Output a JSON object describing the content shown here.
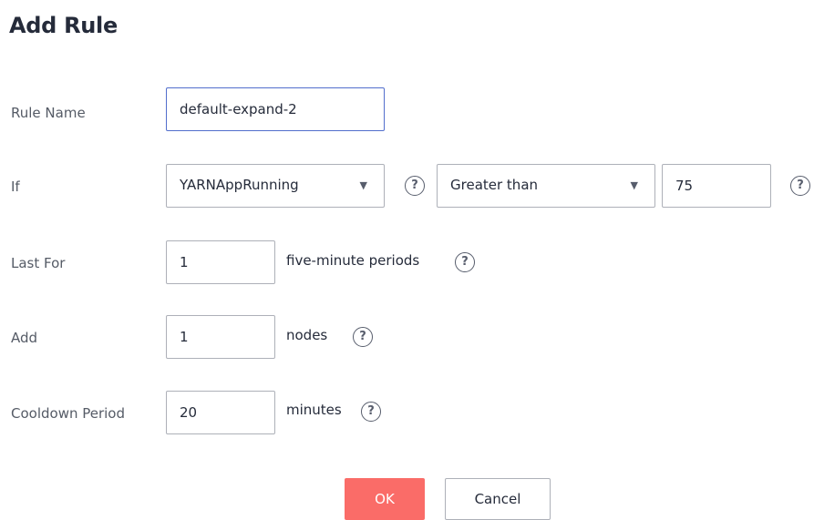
{
  "dialog": {
    "title": "Add Rule"
  },
  "rule_name": {
    "label": "Rule Name",
    "value": "default-expand-2"
  },
  "condition": {
    "label": "If",
    "metric": "YARNAppRunning",
    "operator": "Greater than",
    "threshold": "75"
  },
  "last_for": {
    "label": "Last For",
    "value": "1",
    "unit": "five-minute periods"
  },
  "add": {
    "label": "Add",
    "value": "1",
    "unit": "nodes"
  },
  "cooldown": {
    "label": "Cooldown Period",
    "value": "20",
    "unit": "minutes"
  },
  "help_glyph": "?",
  "caret_glyph": "▼",
  "buttons": {
    "ok": "OK",
    "cancel": "Cancel"
  },
  "colors": {
    "primary": "#fa6c68",
    "focus_border": "#526ecc",
    "border": "#adb0b8"
  }
}
